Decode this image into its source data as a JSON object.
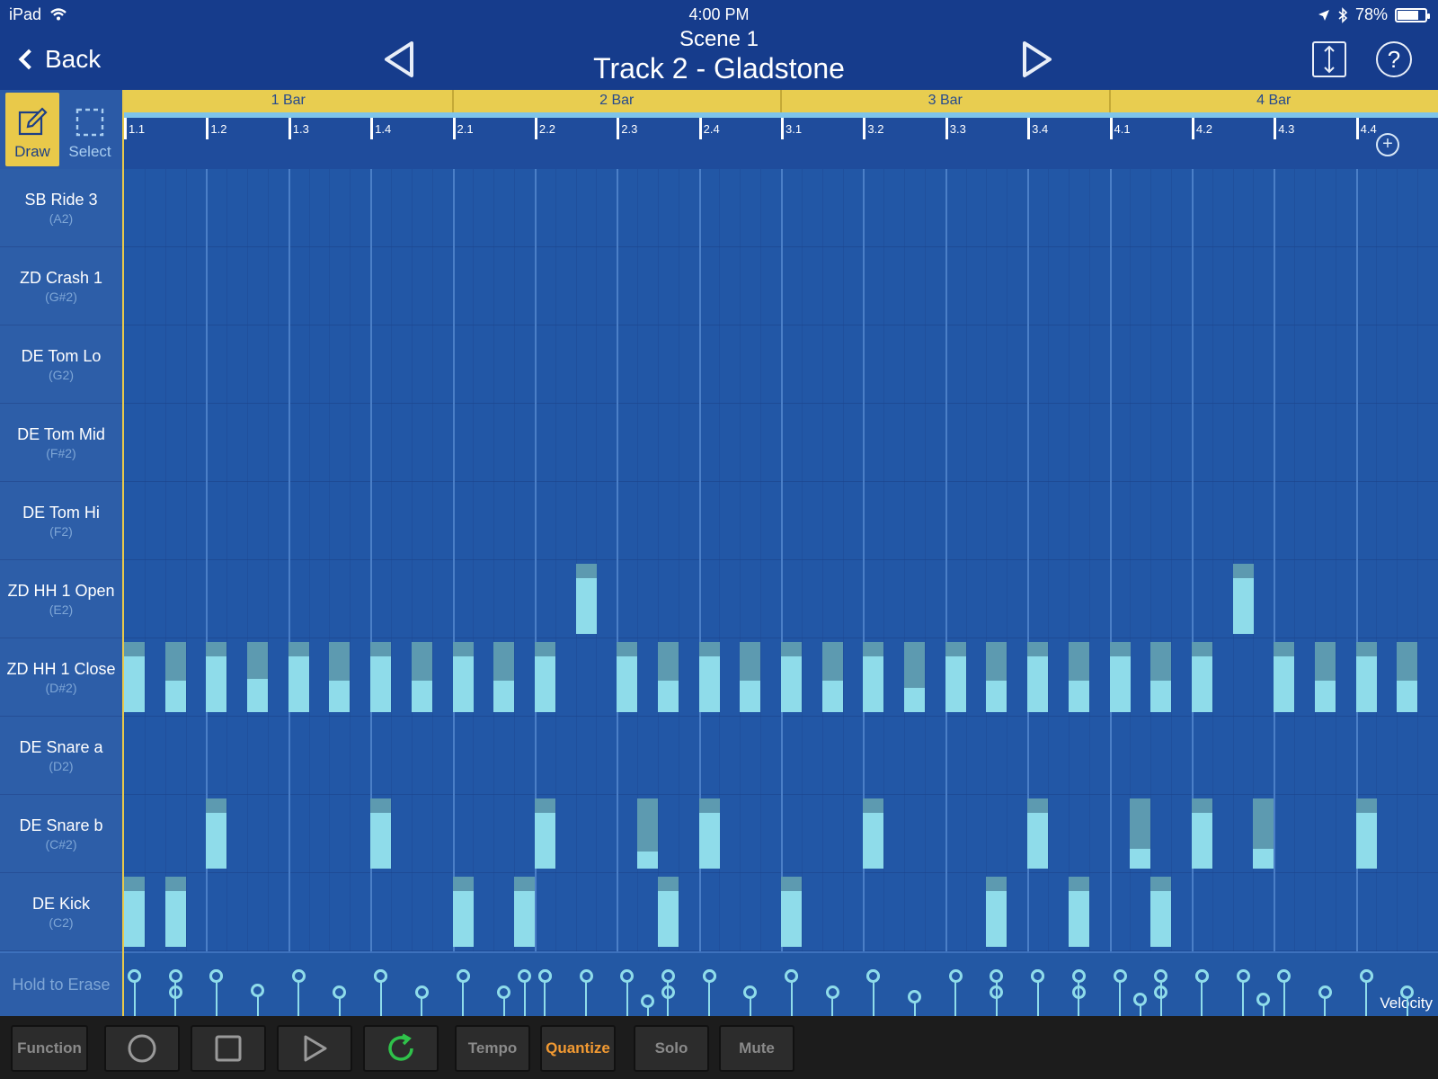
{
  "status": {
    "device": "iPad",
    "time": "4:00 PM",
    "battery": "78%",
    "battery_level": 0.78
  },
  "header": {
    "back_label": "Back",
    "scene": "Scene  1",
    "track": "Track 2 - Gladstone"
  },
  "tools": {
    "draw": "Draw",
    "select": "Select"
  },
  "ruler": {
    "bars": [
      "1 Bar",
      "2 Bar",
      "3 Bar",
      "4 Bar"
    ],
    "beats": [
      "1.1",
      "1.2",
      "1.3",
      "1.4",
      "2.1",
      "2.2",
      "2.3",
      "2.4",
      "3.1",
      "3.2",
      "3.3",
      "3.4",
      "4.1",
      "4.2",
      "4.3",
      "4.4"
    ]
  },
  "instruments": [
    {
      "name": "SB Ride 3",
      "note": "(A2)"
    },
    {
      "name": "ZD Crash 1",
      "note": "(G#2)"
    },
    {
      "name": "DE Tom Lo",
      "note": "(G2)"
    },
    {
      "name": "DE Tom Mid",
      "note": "(F#2)"
    },
    {
      "name": "DE Tom Hi",
      "note": "(F2)"
    },
    {
      "name": "ZD HH 1 Open",
      "note": "(E2)"
    },
    {
      "name": "ZD HH 1 Close",
      "note": "(D#2)"
    },
    {
      "name": "DE Snare a",
      "note": "(D2)"
    },
    {
      "name": "DE Snare b",
      "note": "(C#2)"
    },
    {
      "name": "DE Kick",
      "note": "(C2)"
    }
  ],
  "notes": [
    {
      "lane": 5,
      "step": 11,
      "velocity": 0.8
    },
    {
      "lane": 5,
      "step": 27,
      "velocity": 0.8
    },
    {
      "lane": 6,
      "step": 0,
      "velocity": 0.8
    },
    {
      "lane": 6,
      "step": 1,
      "velocity": 0.45
    },
    {
      "lane": 6,
      "step": 2,
      "velocity": 0.8
    },
    {
      "lane": 6,
      "step": 3,
      "velocity": 0.48
    },
    {
      "lane": 6,
      "step": 4,
      "velocity": 0.8
    },
    {
      "lane": 6,
      "step": 5,
      "velocity": 0.45
    },
    {
      "lane": 6,
      "step": 6,
      "velocity": 0.8
    },
    {
      "lane": 6,
      "step": 7,
      "velocity": 0.45
    },
    {
      "lane": 6,
      "step": 8,
      "velocity": 0.8
    },
    {
      "lane": 6,
      "step": 9,
      "velocity": 0.45
    },
    {
      "lane": 6,
      "step": 10,
      "velocity": 0.8
    },
    {
      "lane": 6,
      "step": 12,
      "velocity": 0.8
    },
    {
      "lane": 6,
      "step": 13,
      "velocity": 0.45
    },
    {
      "lane": 6,
      "step": 14,
      "velocity": 0.8
    },
    {
      "lane": 6,
      "step": 15,
      "velocity": 0.45
    },
    {
      "lane": 6,
      "step": 16,
      "velocity": 0.8
    },
    {
      "lane": 6,
      "step": 17,
      "velocity": 0.45
    },
    {
      "lane": 6,
      "step": 18,
      "velocity": 0.8
    },
    {
      "lane": 6,
      "step": 19,
      "velocity": 0.35
    },
    {
      "lane": 6,
      "step": 20,
      "velocity": 0.8
    },
    {
      "lane": 6,
      "step": 21,
      "velocity": 0.45
    },
    {
      "lane": 6,
      "step": 22,
      "velocity": 0.8
    },
    {
      "lane": 6,
      "step": 23,
      "velocity": 0.45
    },
    {
      "lane": 6,
      "step": 24,
      "velocity": 0.8
    },
    {
      "lane": 6,
      "step": 25,
      "velocity": 0.45
    },
    {
      "lane": 6,
      "step": 26,
      "velocity": 0.8
    },
    {
      "lane": 6,
      "step": 28,
      "velocity": 0.8
    },
    {
      "lane": 6,
      "step": 29,
      "velocity": 0.45
    },
    {
      "lane": 6,
      "step": 30,
      "velocity": 0.8
    },
    {
      "lane": 6,
      "step": 31,
      "velocity": 0.45
    },
    {
      "lane": 8,
      "step": 2,
      "velocity": 0.8
    },
    {
      "lane": 8,
      "step": 6,
      "velocity": 0.8
    },
    {
      "lane": 8,
      "step": 10,
      "velocity": 0.8
    },
    {
      "lane": 8,
      "step": 12.5,
      "velocity": 0.25
    },
    {
      "lane": 8,
      "step": 14,
      "velocity": 0.8
    },
    {
      "lane": 8,
      "step": 18,
      "velocity": 0.8
    },
    {
      "lane": 8,
      "step": 22,
      "velocity": 0.8
    },
    {
      "lane": 8,
      "step": 24.5,
      "velocity": 0.28
    },
    {
      "lane": 8,
      "step": 26,
      "velocity": 0.8
    },
    {
      "lane": 8,
      "step": 27.5,
      "velocity": 0.28
    },
    {
      "lane": 8,
      "step": 30,
      "velocity": 0.8
    },
    {
      "lane": 9,
      "step": 0,
      "velocity": 0.8
    },
    {
      "lane": 9,
      "step": 1,
      "velocity": 0.8
    },
    {
      "lane": 9,
      "step": 8,
      "velocity": 0.8
    },
    {
      "lane": 9,
      "step": 9.5,
      "velocity": 0.8
    },
    {
      "lane": 9,
      "step": 13,
      "velocity": 0.8
    },
    {
      "lane": 9,
      "step": 16,
      "velocity": 0.8
    },
    {
      "lane": 9,
      "step": 21,
      "velocity": 0.8
    },
    {
      "lane": 9,
      "step": 23,
      "velocity": 0.8
    },
    {
      "lane": 9,
      "step": 25,
      "velocity": 0.8
    }
  ],
  "velocity_lane": {
    "erase_label": "Hold to Erase",
    "label": "Velocity"
  },
  "transport": {
    "function": "Function",
    "tempo": "Tempo",
    "quantize": "Quantize",
    "solo": "Solo",
    "mute": "Mute"
  },
  "colors": {
    "accent": "#e9c94a",
    "note": "#8fdcea",
    "quantize": "#f29a32",
    "loop": "#2fc24a"
  }
}
